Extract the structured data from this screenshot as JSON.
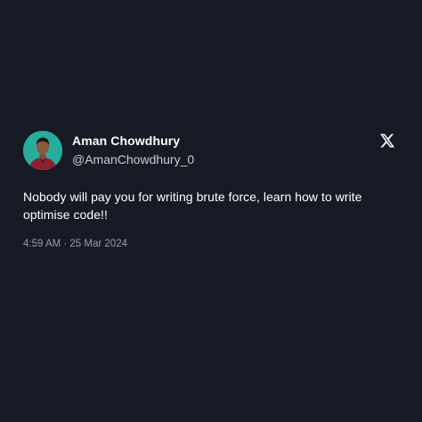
{
  "colors": {
    "background": "#171a24",
    "avatar_bg": "#2bb3a3",
    "text_primary": "#ffffff",
    "text_secondary": "#c9ccd4",
    "text_muted": "#9a9ea8"
  },
  "tweet": {
    "author_name": "Aman Chowdhury",
    "author_handle": "@AmanChowdhury_0",
    "text": "Nobody will pay you for writing brute force, learn how to write optimise code!!",
    "timestamp": "4:59 AM · 25 Mar 2024",
    "avatar_icon": "profile-photo",
    "brand_icon": "x-logo-icon"
  }
}
